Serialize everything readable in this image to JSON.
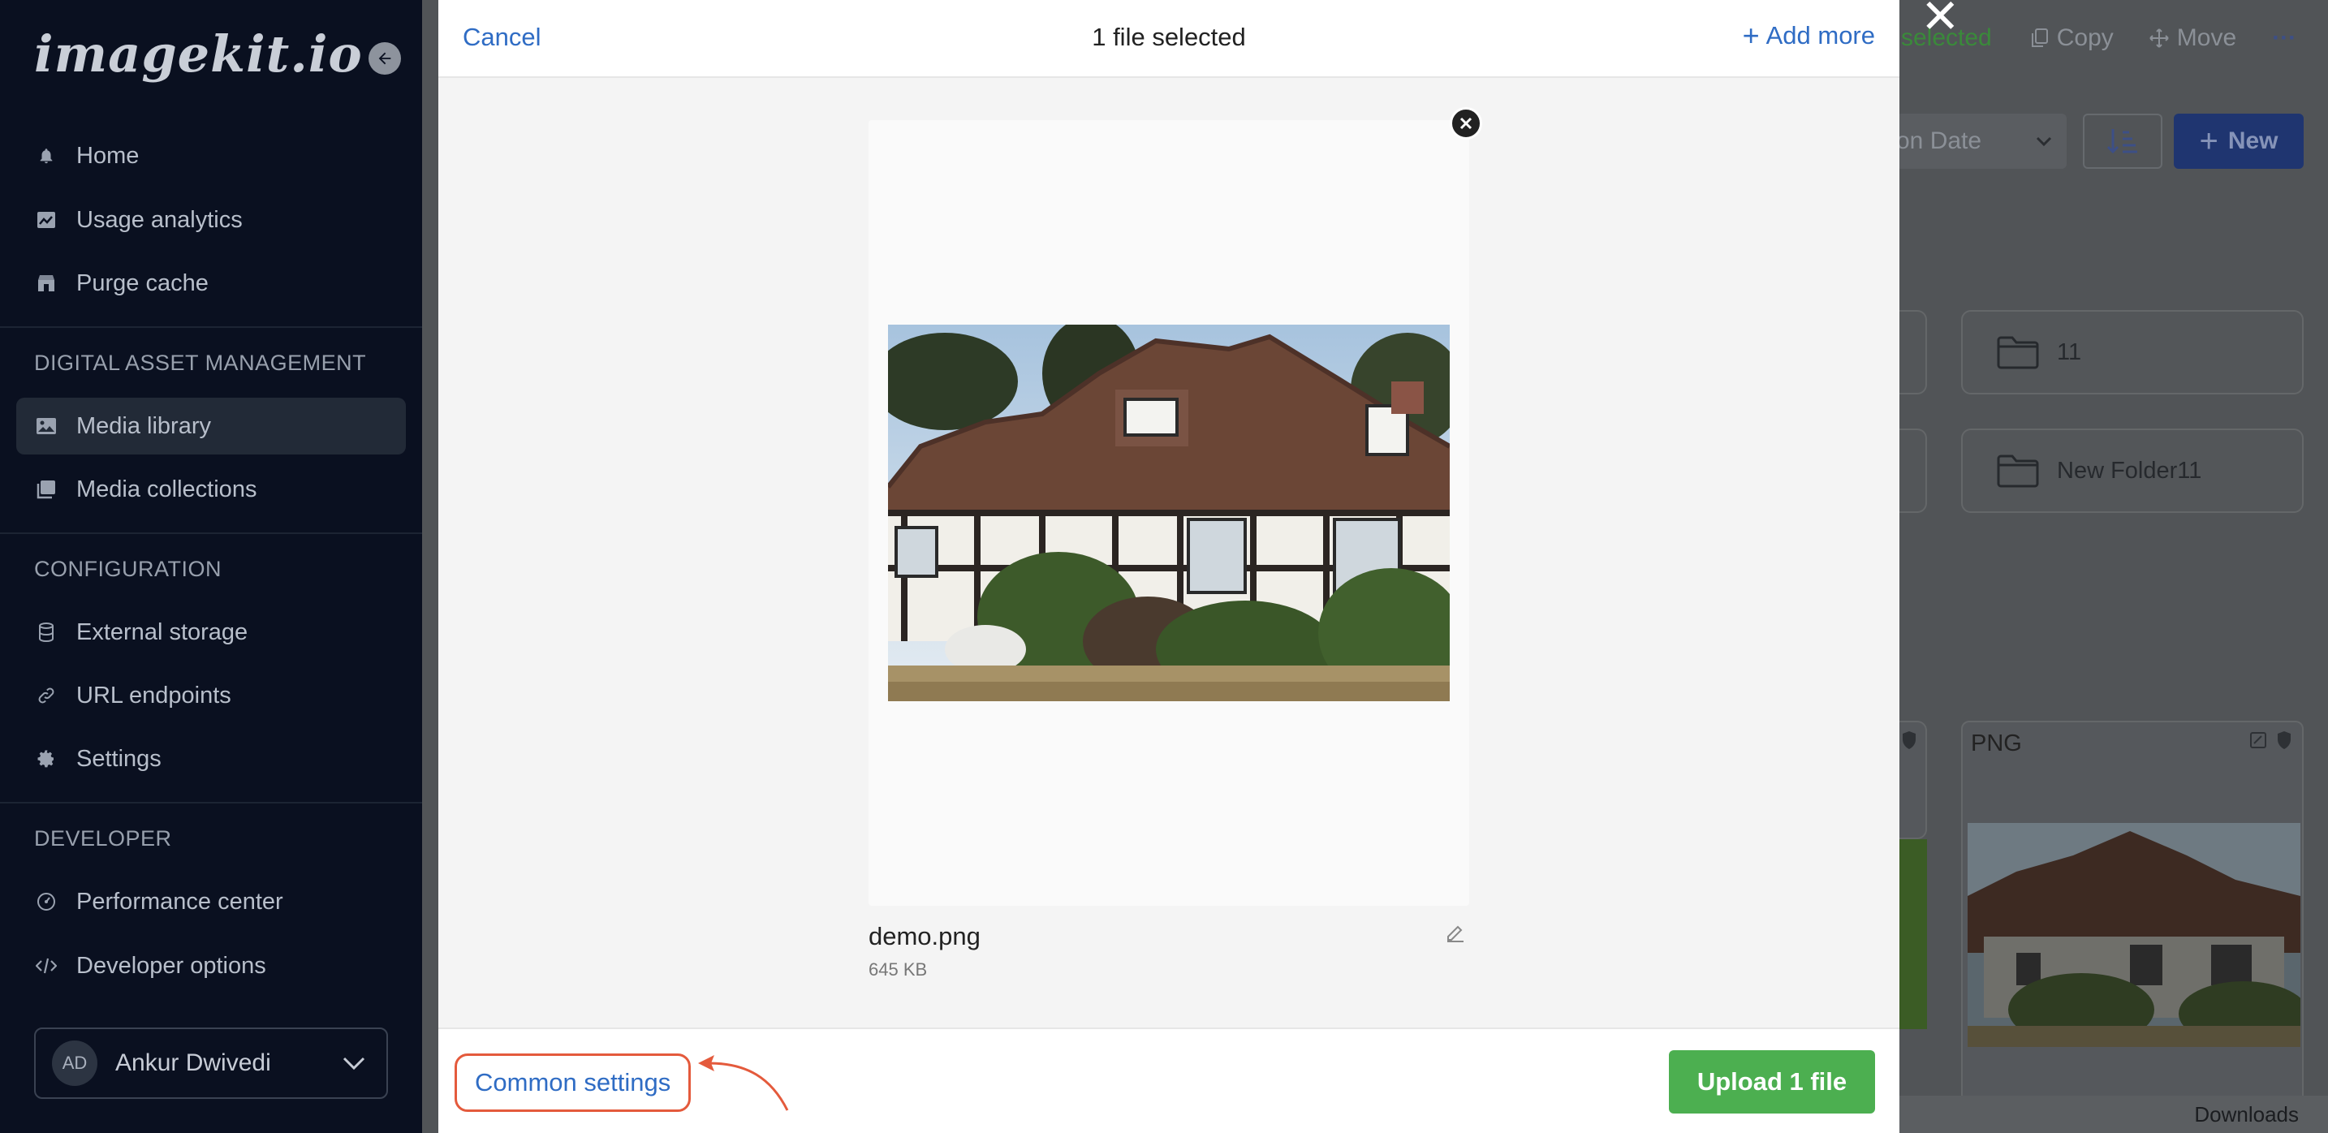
{
  "sidebar": {
    "logo": "imagekit.io",
    "items_top": [
      {
        "label": "Home",
        "icon": "bell-icon"
      },
      {
        "label": "Usage analytics",
        "icon": "chart-icon"
      },
      {
        "label": "Purge cache",
        "icon": "store-icon"
      }
    ],
    "section_dam": "DIGITAL ASSET MANAGEMENT",
    "items_dam": [
      {
        "label": "Media library",
        "icon": "image-icon",
        "active": true
      },
      {
        "label": "Media collections",
        "icon": "collection-icon"
      }
    ],
    "section_config": "CONFIGURATION",
    "items_config": [
      {
        "label": "External storage",
        "icon": "database-icon"
      },
      {
        "label": "URL endpoints",
        "icon": "link-icon"
      },
      {
        "label": "Settings",
        "icon": "gear-icon"
      }
    ],
    "section_dev": "DEVELOPER",
    "items_dev": [
      {
        "label": "Performance center",
        "icon": "gauge-icon"
      },
      {
        "label": "Developer options",
        "icon": "code-icon"
      }
    ],
    "user": {
      "initials": "AD",
      "name": "Ankur Dwivedi"
    }
  },
  "background": {
    "selected_text": "selected",
    "copy_label": "Copy",
    "move_label": "Move",
    "more_label": "···",
    "sort_label": "on Date",
    "new_label": "New",
    "folders": [
      "11",
      "New Folder11"
    ],
    "card_label": "PNG",
    "downloads": "Downloads"
  },
  "modal": {
    "cancel": "Cancel",
    "title": "1 file selected",
    "add_more": "Add more",
    "file": {
      "name": "demo.png",
      "size": "645 KB"
    },
    "common_settings": "Common settings",
    "upload": "Upload 1 file"
  },
  "colors": {
    "accent_link": "#2f6cc4",
    "upload_green": "#4caf50",
    "highlight_red": "#e45a3c",
    "sidebar_bg": "#0a1020"
  }
}
